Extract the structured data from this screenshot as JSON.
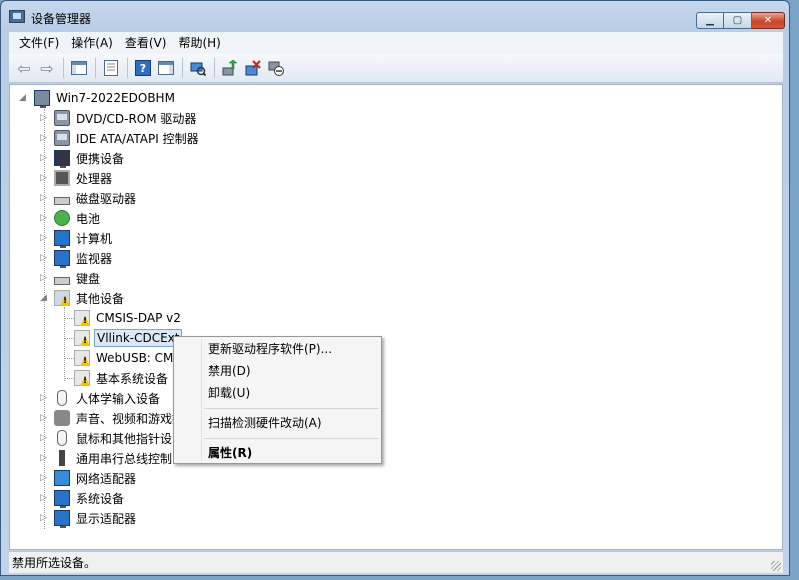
{
  "window": {
    "title": "设备管理器",
    "minimize": "▁",
    "maximize": "▢",
    "close": "✕"
  },
  "menu": [
    "文件(F)",
    "操作(A)",
    "查看(V)",
    "帮助(H)"
  ],
  "tree": {
    "root": "Win7-2022EDOBHM",
    "categories": [
      "DVD/CD-ROM 驱动器",
      "IDE ATA/ATAPI 控制器",
      "便携设备",
      "处理器",
      "磁盘驱动器",
      "电池",
      "计算机",
      "监视器",
      "键盘",
      "其他设备",
      "人体学输入设备",
      "声音、视频和游戏控",
      "鼠标和其他指针设",
      "通用串行总线控制",
      "网络适配器",
      "系统设备",
      "显示适配器"
    ],
    "other_devices": [
      "CMSIS-DAP v2",
      "Vllink-CDCExt",
      "WebUSB: CMS",
      "基本系统设备"
    ],
    "selected": "Vllink-CDCExt"
  },
  "context_menu": {
    "update": "更新驱动程序软件(P)...",
    "disable": "禁用(D)",
    "uninstall": "卸载(U)",
    "scan": "扫描检测硬件改动(A)",
    "properties": "属性(R)"
  },
  "status": "禁用所选设备。"
}
